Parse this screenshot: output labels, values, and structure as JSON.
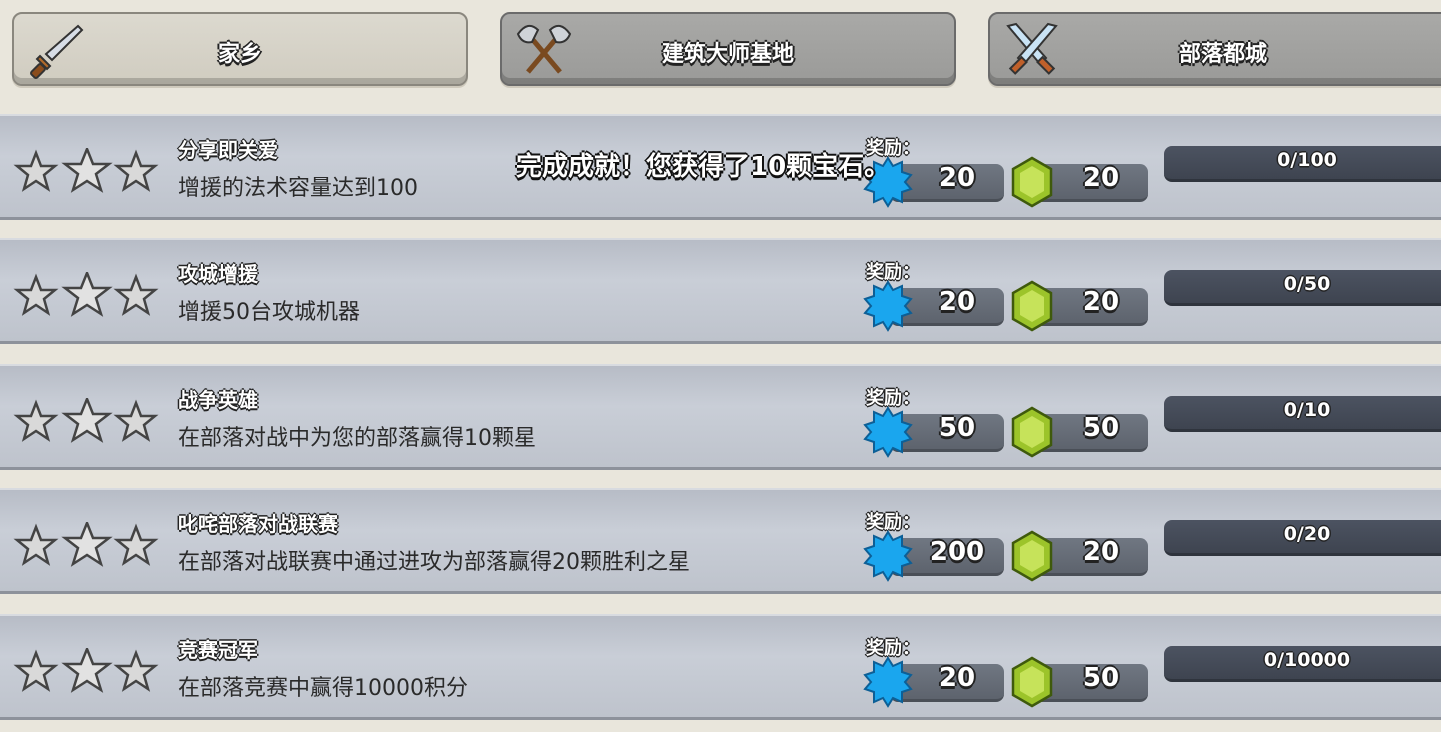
{
  "tabs": [
    {
      "label": "家乡",
      "icon": "sword-icon",
      "active": true
    },
    {
      "label": "建筑大师基地",
      "icon": "crossed-axes-icon",
      "active": false
    },
    {
      "label": "部落都城",
      "icon": "crossed-swords-icon",
      "active": false
    }
  ],
  "reward_label": "奖励：",
  "toast": "完成成就！您获得了10颗宝石。",
  "achievements": [
    {
      "title": "分享即关爱",
      "desc": "增援的法术容量达到100",
      "xp": "20",
      "gems": "20",
      "progress": "0/100"
    },
    {
      "title": "攻城增援",
      "desc": "增援50台攻城机器",
      "xp": "20",
      "gems": "20",
      "progress": "0/50"
    },
    {
      "title": "战争英雄",
      "desc": "在部落对战中为您的部落赢得10颗星",
      "xp": "50",
      "gems": "50",
      "progress": "0/10"
    },
    {
      "title": "叱咤部落对战联赛",
      "desc": "在部落对战联赛中通过进攻为部落赢得20颗胜利之星",
      "xp": "200",
      "gems": "20",
      "progress": "0/20"
    },
    {
      "title": "竞赛冠军",
      "desc": "在部落竞赛中赢得10000积分",
      "xp": "20",
      "gems": "50",
      "progress": "0/10000"
    }
  ],
  "colors": {
    "xp": "#1aa6ee",
    "gem": "#a6cc2a",
    "star_empty": "#d9d9d9"
  }
}
